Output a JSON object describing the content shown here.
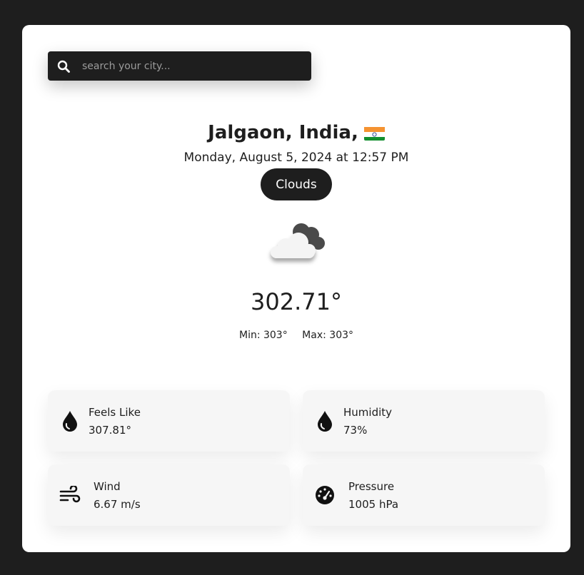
{
  "search": {
    "placeholder": "search your city...",
    "icon": "search-icon"
  },
  "location": {
    "name": "Jalgaon, India,",
    "flag_icon": "india-flag-icon"
  },
  "datetime": "Monday, August 5, 2024 at 12:57 PM",
  "condition": "Clouds",
  "weather_icon": "clouds-icon",
  "temperature": "302.71°",
  "min_label": "Min: 303°",
  "max_label": "Max: 303°",
  "stats": {
    "feels_like": {
      "label": "Feels Like",
      "value": "307.81°",
      "icon": "droplet-icon"
    },
    "humidity": {
      "label": "Humidity",
      "value": "73%",
      "icon": "droplet-icon"
    },
    "wind": {
      "label": "Wind",
      "value": "6.67 m/s",
      "icon": "wind-icon"
    },
    "pressure": {
      "label": "Pressure",
      "value": "1005 hPa",
      "icon": "gauge-icon"
    }
  },
  "colors": {
    "background": "#1e1e1e",
    "card": "#ffffff",
    "stat_card": "#f6f6f6",
    "text": "#1e1e1e"
  }
}
